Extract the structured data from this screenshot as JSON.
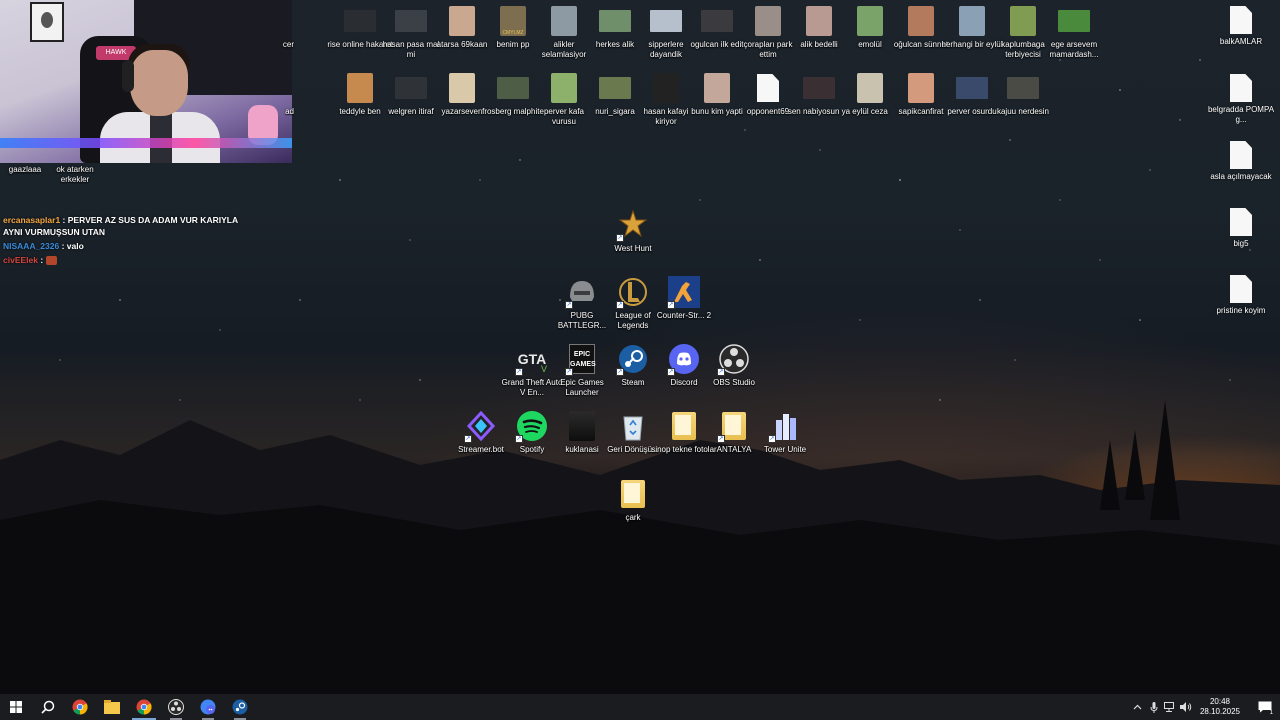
{
  "webcam": {
    "chair_brand": "HAWK"
  },
  "webcam_labels": [
    "gaazlaaa",
    "ok atarken erkekler"
  ],
  "chat": [
    {
      "user": "ercanasaplar1",
      "sep": " : ",
      "message": "PERVER AZ SUS DA ADAM VUR KARIYLA AYNI VURMUŞSUN UTAN",
      "color": "#f4a640"
    },
    {
      "user": "NISAAA_2326",
      "sep": " : ",
      "message": "valo",
      "color": "#3a8bd9"
    },
    {
      "user": "civEElek",
      "sep": " : ",
      "message": "",
      "color": "#d4453b"
    }
  ],
  "top_row1": [
    "cer",
    "rise online hakaret",
    "hasan pasa mal mi",
    "atarsa 69kaan",
    "benim pp",
    "alikler selamlasiyor",
    "herkes alik",
    "sipperlere dayandik",
    "ogulcan ilk edit",
    "çorapları park ettim",
    "alik bedelli",
    "emolül",
    "oğulcan sünnet",
    "herhangi bir eylül",
    "kaplumbaga terbiyecisi",
    "ege arsevem mamardash..."
  ],
  "top_row2": [
    "ad",
    "teddyle ben",
    "welgren itiraf",
    "yazarseven",
    "frosberg malphite",
    "perver kafa vurusu",
    "nuri_sigara",
    "hasan kafayi kiriyor",
    "bunu kim yapti",
    "opponent69",
    "sen nabiyosun ya",
    "eylül ceza",
    "sapikcanfirat",
    "perver osurdu",
    "kajuu nerdesin"
  ],
  "benim_pp_caption": "CMYLMZ",
  "apps": {
    "west_hunt": "West Hunt",
    "pubg": "PUBG BATTLEGR...",
    "lol": "League of Legends",
    "cs2": "Counter-Str... 2",
    "gta": "Grand Theft Auto V En...",
    "epic": "Epic Games Launcher",
    "epic_logo": "EPIC GAMES",
    "steam": "Steam",
    "discord": "Discord",
    "obs": "OBS Studio",
    "streamerbot": "Streamer.bot",
    "spotify": "Spotify",
    "kuklanasi": "kuklanasi",
    "recycle": "Geri Dönüşü...",
    "sinop": "sinop tekne fotolar",
    "antalya": "ANTALYA",
    "tower": "Tower Unite",
    "cark": "çark"
  },
  "right_files": [
    "balkAMLAR",
    "belgradda POMPA g...",
    "asla açılmayacak",
    "big5",
    "pristine koyim"
  ],
  "taskbar": {
    "apps": [
      "start-icon",
      "search-icon",
      "chrome-icon",
      "file-explorer-icon",
      "chrome-active-icon",
      "obs-icon",
      "chrome-discord-icon",
      "steam-icon"
    ],
    "time": "20:48",
    "date": "28.10.2025",
    "notification_count": "1"
  }
}
